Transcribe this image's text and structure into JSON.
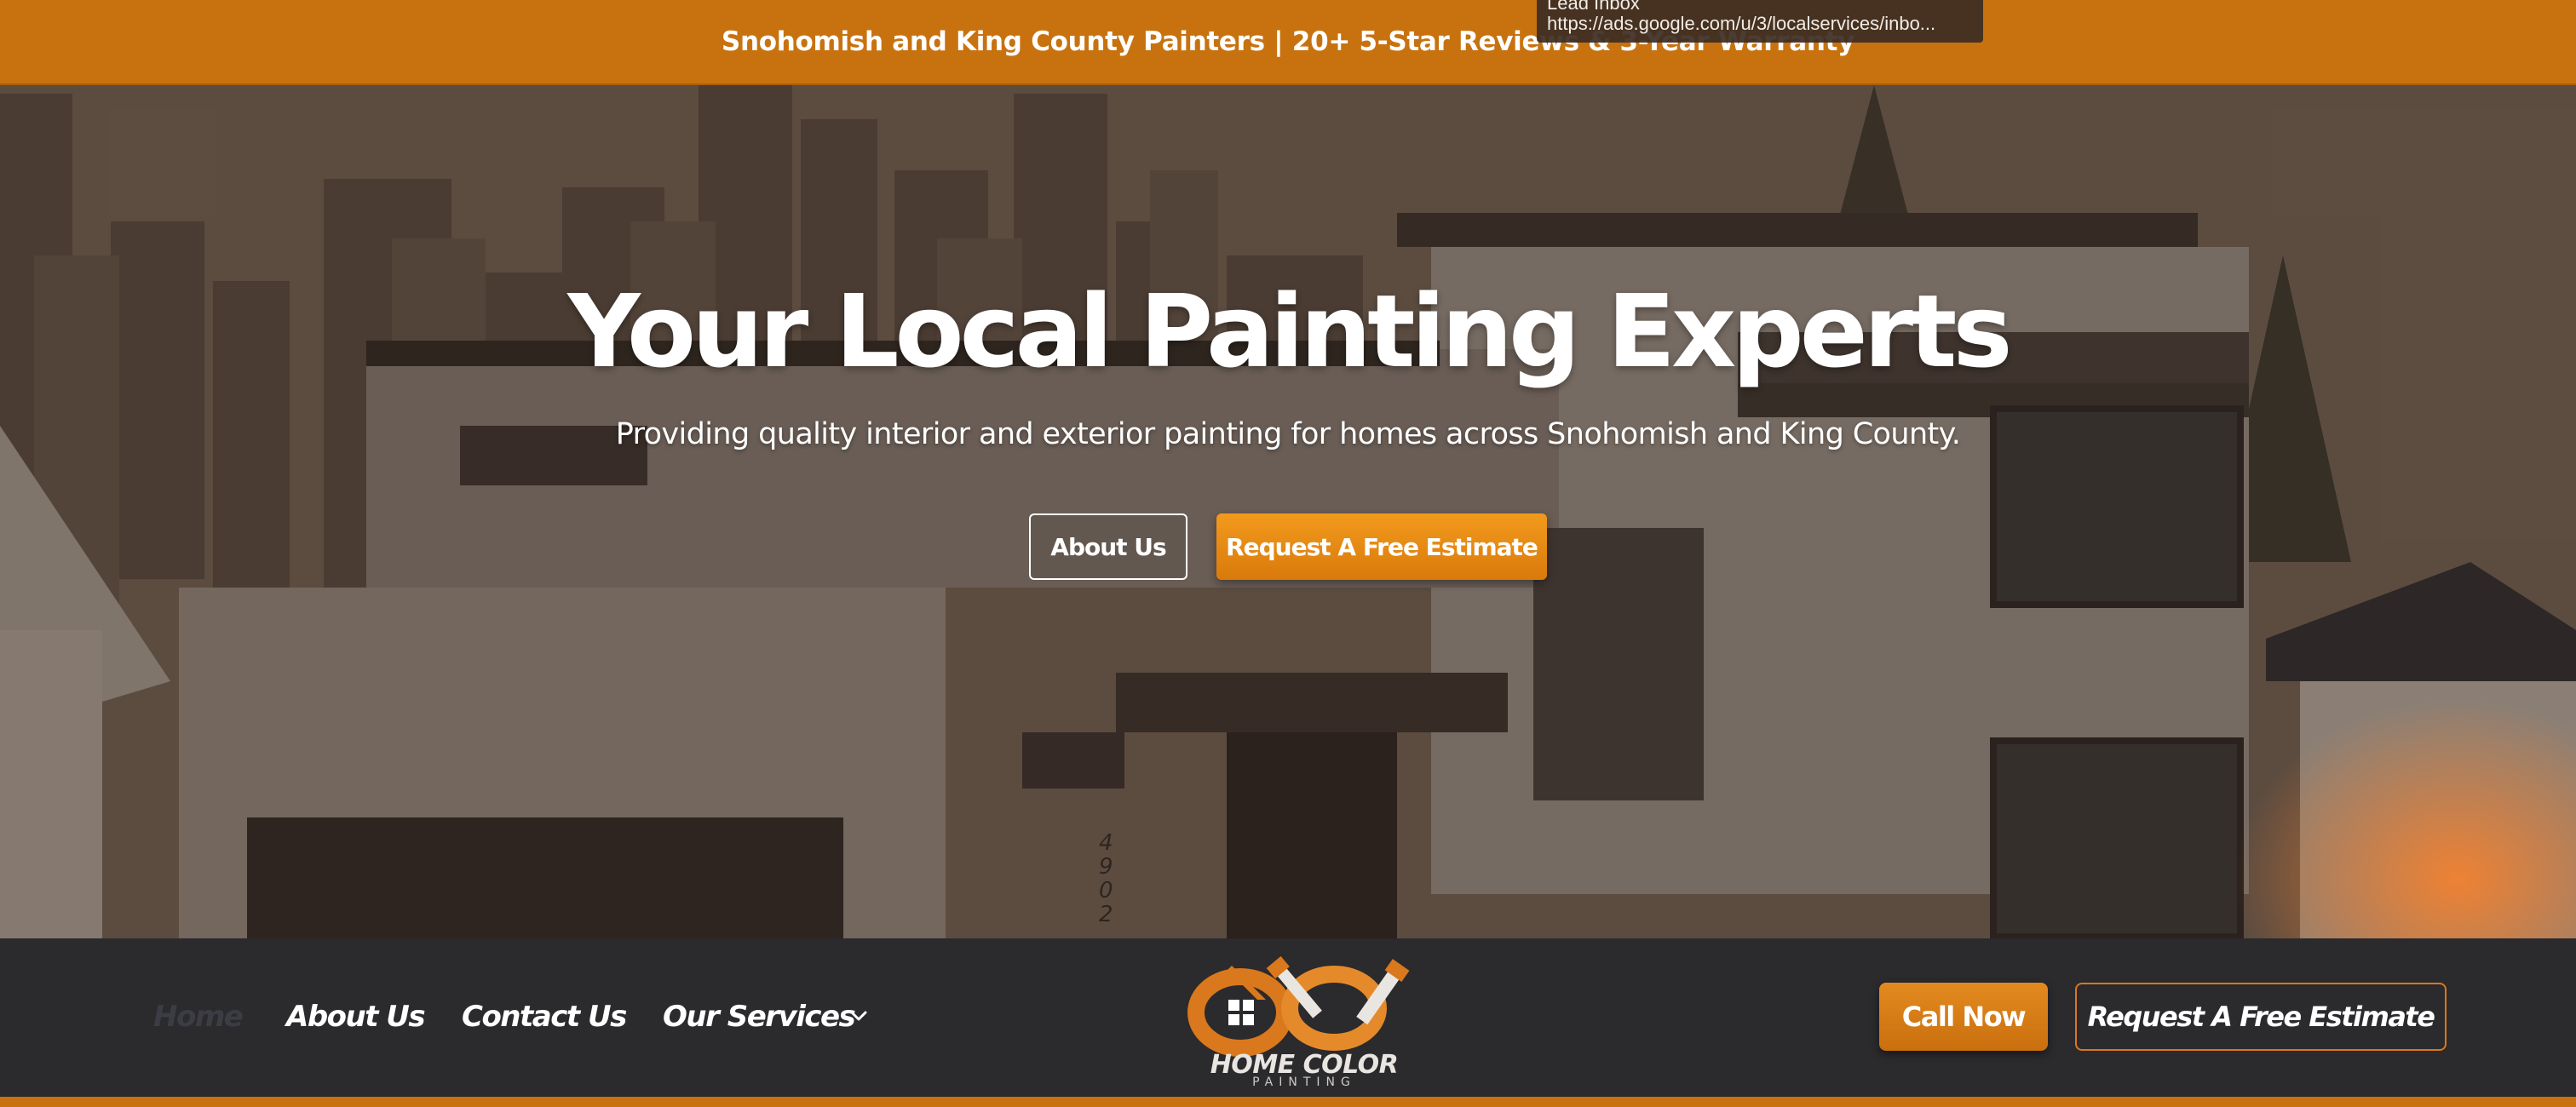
{
  "announcement": {
    "text": "Snohomish and King County Painters | 20+ 5-Star Reviews & 3-Year Warranty"
  },
  "tooltip": {
    "title": "Lead Inbox",
    "url": "https://ads.google.com/u/3/localservices/inbo..."
  },
  "hero": {
    "headline": "Your Local Painting Experts",
    "subline": "Providing quality interior and exterior painting for homes across Snohomish and King County.",
    "about_button": "About Us",
    "estimate_button": "Request A Free Estimate",
    "house_number": [
      "4",
      "9",
      "0",
      "2"
    ]
  },
  "nav": {
    "items": [
      {
        "label": "Home"
      },
      {
        "label": "About Us"
      },
      {
        "label": "Contact Us"
      },
      {
        "label": "Our Services"
      }
    ],
    "logo_title": "HOME COLOR",
    "logo_sub": "PAINTING",
    "call_button": "Call Now",
    "estimate_button": "Request A Free Estimate"
  },
  "colors": {
    "accent": "#c8720f",
    "accent_bright": "#f29a1d",
    "navbar_bg": "#2b2a2d",
    "nav_active": "#3c3d44"
  }
}
